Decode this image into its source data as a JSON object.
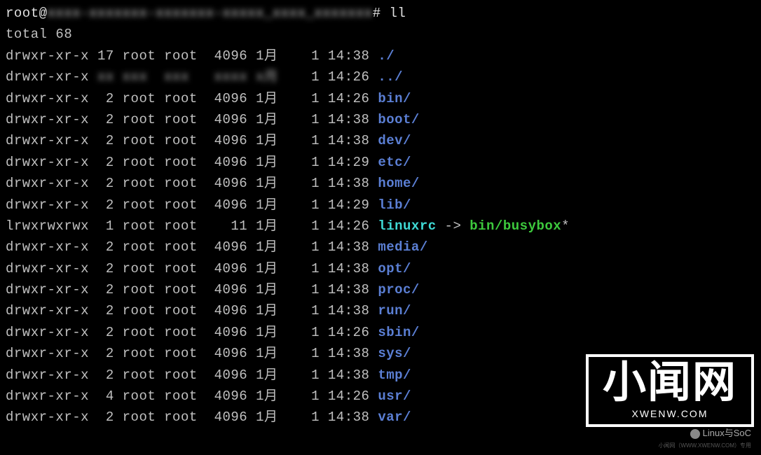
{
  "prompt": {
    "user_host": "root@",
    "blurred_path": "xxxx-xxxxxxx-xxxxxxx-xxxxx_xxxx_xxxxxxx",
    "suffix": "# ",
    "command": "ll"
  },
  "total_line": "total 68",
  "entries": [
    {
      "perms": "drwxr-xr-x",
      "links": "17",
      "owner": "root",
      "group": "root",
      "size": "4096",
      "month": "1月",
      "day": "1",
      "time": "14:38",
      "name": "./",
      "type": "dir",
      "blurred": false
    },
    {
      "perms": "drwxr-xr-x",
      "links": "xx",
      "owner": "xxx",
      "group": "xxx",
      "size": "xxxx",
      "month": "x月",
      "day": "1",
      "time": "14:26",
      "name": "../",
      "type": "dir",
      "blurred": true
    },
    {
      "perms": "drwxr-xr-x",
      "links": " 2",
      "owner": "root",
      "group": "root",
      "size": "4096",
      "month": "1月",
      "day": "1",
      "time": "14:26",
      "name": "bin/",
      "type": "dir",
      "blurred": false
    },
    {
      "perms": "drwxr-xr-x",
      "links": " 2",
      "owner": "root",
      "group": "root",
      "size": "4096",
      "month": "1月",
      "day": "1",
      "time": "14:38",
      "name": "boot/",
      "type": "dir",
      "blurred": false
    },
    {
      "perms": "drwxr-xr-x",
      "links": " 2",
      "owner": "root",
      "group": "root",
      "size": "4096",
      "month": "1月",
      "day": "1",
      "time": "14:38",
      "name": "dev/",
      "type": "dir",
      "blurred": false
    },
    {
      "perms": "drwxr-xr-x",
      "links": " 2",
      "owner": "root",
      "group": "root",
      "size": "4096",
      "month": "1月",
      "day": "1",
      "time": "14:29",
      "name": "etc/",
      "type": "dir",
      "blurred": false
    },
    {
      "perms": "drwxr-xr-x",
      "links": " 2",
      "owner": "root",
      "group": "root",
      "size": "4096",
      "month": "1月",
      "day": "1",
      "time": "14:38",
      "name": "home/",
      "type": "dir",
      "blurred": false
    },
    {
      "perms": "drwxr-xr-x",
      "links": " 2",
      "owner": "root",
      "group": "root",
      "size": "4096",
      "month": "1月",
      "day": "1",
      "time": "14:29",
      "name": "lib/",
      "type": "dir",
      "blurred": false
    },
    {
      "perms": "lrwxrwxrwx",
      "links": " 1",
      "owner": "root",
      "group": "root",
      "size": "  11",
      "month": "1月",
      "day": "1",
      "time": "14:26",
      "name": "linuxrc",
      "type": "link",
      "target": "bin/busybox",
      "suffix": "*",
      "blurred": false
    },
    {
      "perms": "drwxr-xr-x",
      "links": " 2",
      "owner": "root",
      "group": "root",
      "size": "4096",
      "month": "1月",
      "day": "1",
      "time": "14:38",
      "name": "media/",
      "type": "dir",
      "blurred": false
    },
    {
      "perms": "drwxr-xr-x",
      "links": " 2",
      "owner": "root",
      "group": "root",
      "size": "4096",
      "month": "1月",
      "day": "1",
      "time": "14:38",
      "name": "opt/",
      "type": "dir",
      "blurred": false
    },
    {
      "perms": "drwxr-xr-x",
      "links": " 2",
      "owner": "root",
      "group": "root",
      "size": "4096",
      "month": "1月",
      "day": "1",
      "time": "14:38",
      "name": "proc/",
      "type": "dir",
      "blurred": false
    },
    {
      "perms": "drwxr-xr-x",
      "links": " 2",
      "owner": "root",
      "group": "root",
      "size": "4096",
      "month": "1月",
      "day": "1",
      "time": "14:38",
      "name": "run/",
      "type": "dir",
      "blurred": false
    },
    {
      "perms": "drwxr-xr-x",
      "links": " 2",
      "owner": "root",
      "group": "root",
      "size": "4096",
      "month": "1月",
      "day": "1",
      "time": "14:26",
      "name": "sbin/",
      "type": "dir",
      "blurred": false
    },
    {
      "perms": "drwxr-xr-x",
      "links": " 2",
      "owner": "root",
      "group": "root",
      "size": "4096",
      "month": "1月",
      "day": "1",
      "time": "14:38",
      "name": "sys/",
      "type": "dir",
      "blurred": false
    },
    {
      "perms": "drwxr-xr-x",
      "links": " 2",
      "owner": "root",
      "group": "root",
      "size": "4096",
      "month": "1月",
      "day": "1",
      "time": "14:38",
      "name": "tmp/",
      "type": "dir",
      "blurred": false
    },
    {
      "perms": "drwxr-xr-x",
      "links": " 4",
      "owner": "root",
      "group": "root",
      "size": "4096",
      "month": "1月",
      "day": "1",
      "time": "14:26",
      "name": "usr/",
      "type": "dir",
      "blurred": false
    },
    {
      "perms": "drwxr-xr-x",
      "links": " 2",
      "owner": "root",
      "group": "root",
      "size": "4096",
      "month": "1月",
      "day": "1",
      "time": "14:38",
      "name": "var/",
      "type": "dir",
      "blurred": false
    }
  ],
  "watermark": {
    "title": "小闻网",
    "subtitle": "XWENW.COM",
    "wechat": "Linux与SoC",
    "tiny": "小闻网（WWW.XWENW.COM）专用"
  }
}
